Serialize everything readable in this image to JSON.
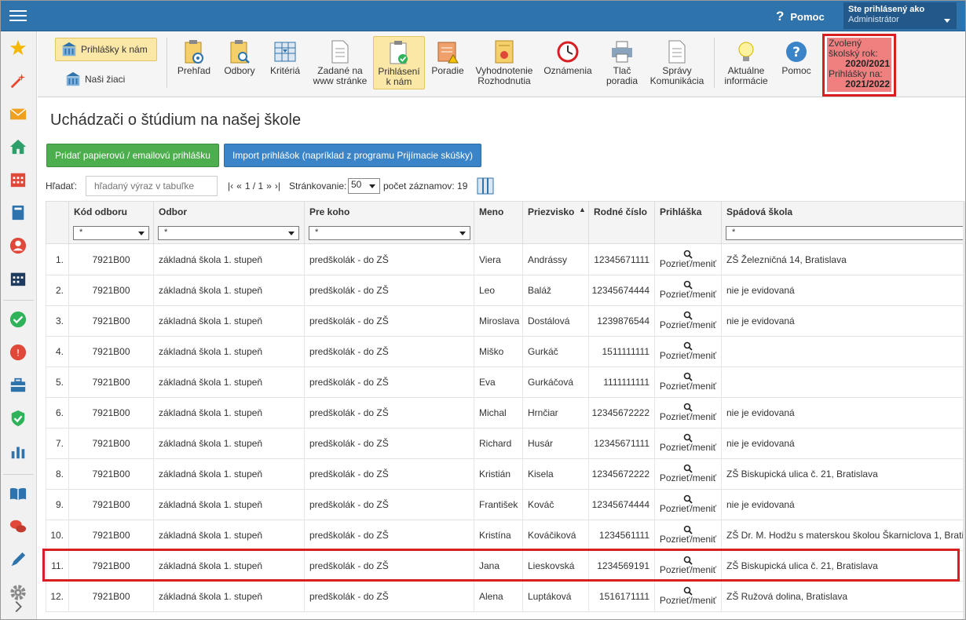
{
  "topbar": {
    "help_label": "Pomoc",
    "help_glyph": "?",
    "user_box_line1": "Ste prihlásený ako",
    "user_box_line2": "Administrátor"
  },
  "sidebar": {
    "icons": [
      "star-icon",
      "magic-wand-icon",
      "envelope-icon",
      "home-icon",
      "calendar-icon",
      "book-icon",
      "user-circle-icon",
      "schedule-icon",
      "check-circle-icon",
      "warning-circle-icon",
      "briefcase-icon",
      "shield-check-icon",
      "bar-chart-icon",
      "open-book-icon",
      "chat-icon",
      "pen-icon",
      "gear-icon",
      "chevron-right-icon"
    ]
  },
  "toolbar": {
    "left_buttons": [
      {
        "label": "Prihlášky k nám",
        "active": true
      },
      {
        "label": "Naši žiaci",
        "active": false
      }
    ],
    "buttons": [
      {
        "line1": "Prehľad",
        "line2": ""
      },
      {
        "line1": "Odbory",
        "line2": ""
      },
      {
        "line1": "Kritériá",
        "line2": ""
      },
      {
        "line1": "Zadané na",
        "line2": "www stránke"
      },
      {
        "line1": "Prihlásení",
        "line2": "k nám"
      },
      {
        "line1": "Poradie",
        "line2": ""
      },
      {
        "line1": "Vyhodnotenie",
        "line2": "Rozhodnutia"
      },
      {
        "line1": "Oznámenia",
        "line2": ""
      },
      {
        "line1": "Tlač",
        "line2": "poradia"
      },
      {
        "line1": "Správy",
        "line2": "Komunikácia"
      },
      {
        "line1": "Aktuálne",
        "line2": "informácie"
      },
      {
        "line1": "Pomoc",
        "line2": ""
      }
    ],
    "year_box": {
      "label1": "Zvolený",
      "label2": "školský rok:",
      "value1": "2020/2021",
      "label3": "Prihlášky na:",
      "value2": "2021/2022"
    }
  },
  "main": {
    "title": "Uchádzači o štúdium na našej škole",
    "btn_add": "Pridať papierovú / emailovú prihlášku",
    "btn_import": "Import prihlášok (napríklad z programu Prijímacie skúšky)",
    "search_label": "Hľadať:",
    "search_placeholder": "hľadaný výraz v tabuľke",
    "pager": {
      "first": "|‹",
      "prev": "«",
      "info": "1 / 1",
      "next": "»",
      "last": "›|"
    },
    "paging_label": "Stránkovanie:",
    "paging_value": "50",
    "count_label": "počet záznamov: 19"
  },
  "table": {
    "headers": {
      "kod": "Kód odboru",
      "odbor": "Odbor",
      "prekoho": "Pre koho",
      "meno": "Meno",
      "priezvisko": "Priezvisko",
      "rodne": "Rodné číslo",
      "prihlaska": "Prihláška",
      "spadova": "Spádová škola"
    },
    "sort_glyph": "▲",
    "filter_value": "*",
    "view_label": "Pozrieť/meniť",
    "rows": [
      {
        "n": "1.",
        "kod": "7921B00",
        "odbor": "základná škola 1. stupeň",
        "prekoho": "predškolák - do ZŠ",
        "meno": "Viera",
        "priezvisko": "Andrássy",
        "rodne": "12345671111",
        "spadova": "ZŠ Železničná 14, Bratislava"
      },
      {
        "n": "2.",
        "kod": "7921B00",
        "odbor": "základná škola 1. stupeň",
        "prekoho": "predškolák - do ZŠ",
        "meno": "Leo",
        "priezvisko": "Baláž",
        "rodne": "12345674444",
        "spadova": "nie je evidovaná"
      },
      {
        "n": "3.",
        "kod": "7921B00",
        "odbor": "základná škola 1. stupeň",
        "prekoho": "predškolák - do ZŠ",
        "meno": "Miroslava",
        "priezvisko": "Dostálová",
        "rodne": "1239876544",
        "spadova": "nie je evidovaná"
      },
      {
        "n": "4.",
        "kod": "7921B00",
        "odbor": "základná škola 1. stupeň",
        "prekoho": "predškolák - do ZŠ",
        "meno": "Miško",
        "priezvisko": "Gurkáč",
        "rodne": "1511111111",
        "spadova": ""
      },
      {
        "n": "5.",
        "kod": "7921B00",
        "odbor": "základná škola 1. stupeň",
        "prekoho": "predškolák - do ZŠ",
        "meno": "Eva",
        "priezvisko": "Gurkáčová",
        "rodne": "1111111111",
        "spadova": ""
      },
      {
        "n": "6.",
        "kod": "7921B00",
        "odbor": "základná škola 1. stupeň",
        "prekoho": "predškolák - do ZŠ",
        "meno": "Michal",
        "priezvisko": "Hrnčiar",
        "rodne": "12345672222",
        "spadova": "nie je evidovaná"
      },
      {
        "n": "7.",
        "kod": "7921B00",
        "odbor": "základná škola 1. stupeň",
        "prekoho": "predškolák - do ZŠ",
        "meno": "Richard",
        "priezvisko": "Husár",
        "rodne": "12345671111",
        "spadova": "nie je evidovaná"
      },
      {
        "n": "8.",
        "kod": "7921B00",
        "odbor": "základná škola 1. stupeň",
        "prekoho": "predškolák - do ZŠ",
        "meno": "Kristián",
        "priezvisko": "Kisela",
        "rodne": "12345672222",
        "spadova": "ZŠ Biskupická ulica č. 21, Bratislava"
      },
      {
        "n": "9.",
        "kod": "7921B00",
        "odbor": "základná škola 1. stupeň",
        "prekoho": "predškolák - do ZŠ",
        "meno": "František",
        "priezvisko": "Kováč",
        "rodne": "12345674444",
        "spadova": "nie je evidovaná"
      },
      {
        "n": "10.",
        "kod": "7921B00",
        "odbor": "základná škola 1. stupeň",
        "prekoho": "predškolák - do ZŠ",
        "meno": "Kristína",
        "priezvisko": "Kováčiková",
        "rodne": "1234561111",
        "spadova": "ZŠ Dr. M. Hodžu s materskou školou Škarniclova 1, Brati"
      },
      {
        "n": "11.",
        "kod": "7921B00",
        "odbor": "základná škola 1. stupeň",
        "prekoho": "predškolák - do ZŠ",
        "meno": "Jana",
        "priezvisko": "Lieskovská",
        "rodne": "1234569191",
        "spadova": "ZŠ Biskupická ulica č. 21, Bratislava"
      },
      {
        "n": "12.",
        "kod": "7921B00",
        "odbor": "základná škola 1. stupeň",
        "prekoho": "predškolák - do ZŠ",
        "meno": "Alena",
        "priezvisko": "Luptáková",
        "rodne": "1516171111",
        "spadova": "ZŠ Ružová dolina, Bratislava"
      }
    ]
  },
  "colors": {
    "topbar": "#2f73ad",
    "highlight_red": "#d81e23",
    "year_box_fill": "#f08080",
    "active_toolbar": "#fbe8a6"
  }
}
